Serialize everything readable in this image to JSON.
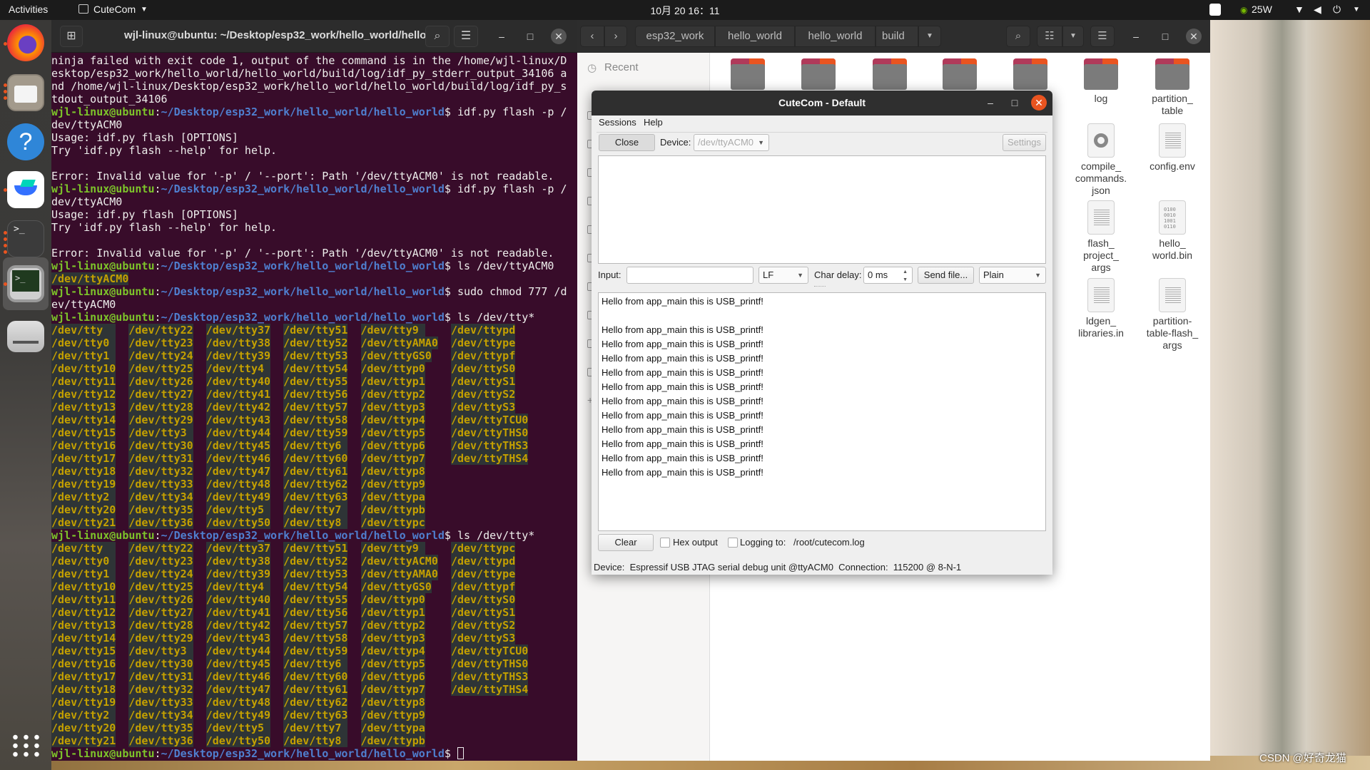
{
  "topbar": {
    "activities": "Activities",
    "app_menu": "CuteCom",
    "clock": "10月 20  16：11",
    "power_draw": "25W"
  },
  "dock": {
    "items": [
      "firefox",
      "files",
      "help",
      "feishu",
      "terminal",
      "terminal-active",
      "drive"
    ],
    "show_apps": "show-apps-grid"
  },
  "terminal": {
    "title": "wjl-linux@ubuntu: ~/Desktop/esp32_work/hello_world/hello...",
    "prompt_user": "wjl-linux@ubuntu",
    "prompt_path": "~/Desktop/esp32_work/hello_world/hello_world",
    "colors": {
      "bg": "#380c2a",
      "user": "#7dc42a",
      "path": "#4f7fcf",
      "highlight_fg": "#c4a000",
      "highlight_bg": "#2e3436"
    },
    "blocks": [
      {
        "type": "text",
        "text": "ninja failed with exit code 1, output of the command is in the /home/wjl-linux/D"
      },
      {
        "type": "text",
        "text": "esktop/esp32_work/hello_world/hello_world/build/log/idf_py_stderr_output_34106 a"
      },
      {
        "type": "text",
        "text": "nd /home/wjl-linux/Desktop/esp32_work/hello_world/hello_world/build/log/idf_py_s"
      },
      {
        "type": "text",
        "text": "tdout_output_34106"
      },
      {
        "type": "prompt",
        "cmd": "$ idf.py flash -p /"
      },
      {
        "type": "text",
        "text": "dev/ttyACM0"
      },
      {
        "type": "text",
        "text": "Usage: idf.py flash [OPTIONS]"
      },
      {
        "type": "text",
        "text": "Try 'idf.py flash --help' for help."
      },
      {
        "type": "text",
        "text": ""
      },
      {
        "type": "text",
        "text": "Error: Invalid value for '-p' / '--port': Path '/dev/ttyACM0' is not readable."
      },
      {
        "type": "prompt",
        "cmd": "$ idf.py flash -p /"
      },
      {
        "type": "text",
        "text": "dev/ttyACM0"
      },
      {
        "type": "text",
        "text": "Usage: idf.py flash [OPTIONS]"
      },
      {
        "type": "text",
        "text": "Try 'idf.py flash --help' for help."
      },
      {
        "type": "text",
        "text": ""
      },
      {
        "type": "text",
        "text": "Error: Invalid value for '-p' / '--port': Path '/dev/ttyACM0' is not readable."
      },
      {
        "type": "prompt",
        "cmd": "$ ls /dev/ttyACM0"
      },
      {
        "type": "hl",
        "text": "/dev/ttyACM0"
      },
      {
        "type": "prompt",
        "cmd": "$ sudo chmod 777 /d"
      },
      {
        "type": "text",
        "text": "ev/ttyACM0"
      },
      {
        "type": "prompt",
        "cmd": "$ ls /dev/tty*"
      },
      {
        "type": "ls",
        "columns": [
          [
            "/dev/tty",
            "/dev/tty0",
            "/dev/tty1",
            "/dev/tty10",
            "/dev/tty11",
            "/dev/tty12",
            "/dev/tty13",
            "/dev/tty14",
            "/dev/tty15",
            "/dev/tty16",
            "/dev/tty17",
            "/dev/tty18",
            "/dev/tty19",
            "/dev/tty2",
            "/dev/tty20",
            "/dev/tty21"
          ],
          [
            "/dev/tty22",
            "/dev/tty23",
            "/dev/tty24",
            "/dev/tty25",
            "/dev/tty26",
            "/dev/tty27",
            "/dev/tty28",
            "/dev/tty29",
            "/dev/tty3",
            "/dev/tty30",
            "/dev/tty31",
            "/dev/tty32",
            "/dev/tty33",
            "/dev/tty34",
            "/dev/tty35",
            "/dev/tty36"
          ],
          [
            "/dev/tty37",
            "/dev/tty38",
            "/dev/tty39",
            "/dev/tty4",
            "/dev/tty40",
            "/dev/tty41",
            "/dev/tty42",
            "/dev/tty43",
            "/dev/tty44",
            "/dev/tty45",
            "/dev/tty46",
            "/dev/tty47",
            "/dev/tty48",
            "/dev/tty49",
            "/dev/tty5",
            "/dev/tty50"
          ],
          [
            "/dev/tty51",
            "/dev/tty52",
            "/dev/tty53",
            "/dev/tty54",
            "/dev/tty55",
            "/dev/tty56",
            "/dev/tty57",
            "/dev/tty58",
            "/dev/tty59",
            "/dev/tty6",
            "/dev/tty60",
            "/dev/tty61",
            "/dev/tty62",
            "/dev/tty63",
            "/dev/tty7",
            "/dev/tty8"
          ],
          [
            "/dev/tty9",
            "/dev/ttyAMA0",
            "/dev/ttyGS0",
            "/dev/ttyp0",
            "/dev/ttyp1",
            "/dev/ttyp2",
            "/dev/ttyp3",
            "/dev/ttyp4",
            "/dev/ttyp5",
            "/dev/ttyp6",
            "/dev/ttyp7",
            "/dev/ttyp8",
            "/dev/ttyp9",
            "/dev/ttypa",
            "/dev/ttypb",
            "/dev/ttypc"
          ],
          [
            "/dev/ttypd",
            "/dev/ttype",
            "/dev/ttypf",
            "/dev/ttyS0",
            "/dev/ttyS1",
            "/dev/ttyS2",
            "/dev/ttyS3",
            "/dev/ttyTCU0",
            "/dev/ttyTHS0",
            "/dev/ttyTHS3",
            "/dev/ttyTHS4"
          ]
        ]
      },
      {
        "type": "prompt",
        "cmd": "$ ls /dev/tty*"
      },
      {
        "type": "ls",
        "columns": [
          [
            "/dev/tty",
            "/dev/tty0",
            "/dev/tty1",
            "/dev/tty10",
            "/dev/tty11",
            "/dev/tty12",
            "/dev/tty13",
            "/dev/tty14",
            "/dev/tty15",
            "/dev/tty16",
            "/dev/tty17",
            "/dev/tty18",
            "/dev/tty19",
            "/dev/tty2",
            "/dev/tty20",
            "/dev/tty21"
          ],
          [
            "/dev/tty22",
            "/dev/tty23",
            "/dev/tty24",
            "/dev/tty25",
            "/dev/tty26",
            "/dev/tty27",
            "/dev/tty28",
            "/dev/tty29",
            "/dev/tty3",
            "/dev/tty30",
            "/dev/tty31",
            "/dev/tty32",
            "/dev/tty33",
            "/dev/tty34",
            "/dev/tty35",
            "/dev/tty36"
          ],
          [
            "/dev/tty37",
            "/dev/tty38",
            "/dev/tty39",
            "/dev/tty4",
            "/dev/tty40",
            "/dev/tty41",
            "/dev/tty42",
            "/dev/tty43",
            "/dev/tty44",
            "/dev/tty45",
            "/dev/tty46",
            "/dev/tty47",
            "/dev/tty48",
            "/dev/tty49",
            "/dev/tty5",
            "/dev/tty50"
          ],
          [
            "/dev/tty51",
            "/dev/tty52",
            "/dev/tty53",
            "/dev/tty54",
            "/dev/tty55",
            "/dev/tty56",
            "/dev/tty57",
            "/dev/tty58",
            "/dev/tty59",
            "/dev/tty6",
            "/dev/tty60",
            "/dev/tty61",
            "/dev/tty62",
            "/dev/tty63",
            "/dev/tty7",
            "/dev/tty8"
          ],
          [
            "/dev/tty9",
            "/dev/ttyACM0",
            "/dev/ttyAMA0",
            "/dev/ttyGS0",
            "/dev/ttyp0",
            "/dev/ttyp1",
            "/dev/ttyp2",
            "/dev/ttyp3",
            "/dev/ttyp4",
            "/dev/ttyp5",
            "/dev/ttyp6",
            "/dev/ttyp7",
            "/dev/ttyp8",
            "/dev/ttyp9",
            "/dev/ttypa",
            "/dev/ttypb"
          ],
          [
            "/dev/ttypc",
            "/dev/ttypd",
            "/dev/ttype",
            "/dev/ttypf",
            "/dev/ttyS0",
            "/dev/ttyS1",
            "/dev/ttyS2",
            "/dev/ttyS3",
            "/dev/ttyTCU0",
            "/dev/ttyTHS0",
            "/dev/ttyTHS3",
            "/dev/ttyTHS4"
          ]
        ]
      },
      {
        "type": "prompt",
        "cmd": "$ ",
        "cursor": true
      }
    ]
  },
  "file_manager": {
    "breadcrumbs": [
      "esp32_work",
      "hello_world",
      "hello_world",
      "build"
    ],
    "sidebar": {
      "recent": "Recent"
    },
    "folders": [
      "",
      "",
      "",
      "",
      "",
      "log",
      "partition_\ntable"
    ],
    "files": [
      {
        "name": "compile_\ncommands.\njson",
        "icon": "json-file-icon"
      },
      {
        "name": "config.env",
        "icon": "text-file-icon"
      },
      {
        "name": "flash_\nproject_\nargs",
        "icon": "text-file-icon"
      },
      {
        "name": "hello_\nworld.bin",
        "icon": "binary-file-icon"
      },
      {
        "name": "ldgen_\nlibraries.in",
        "icon": "text-file-icon"
      },
      {
        "name": "partition-\ntable-flash_\nargs",
        "icon": "text-file-icon"
      }
    ]
  },
  "cutecom": {
    "title": "CuteCom - Default",
    "menu": [
      "Sessions",
      "Help"
    ],
    "close_button": "Close",
    "device_label": "Device:",
    "device_value": "/dev/ttyACM0",
    "settings_button": "Settings",
    "input_label": "Input:",
    "input_value": "",
    "line_end": "LF",
    "char_delay_label": "Char delay:",
    "char_delay_value": "0 ms",
    "send_file_button": "Send file...",
    "format": "Plain",
    "received_lines": [
      "Hello from app_main this is USB_printf!",
      "",
      "Hello from app_main this is USB_printf!",
      "Hello from app_main this is USB_printf!",
      "Hello from app_main this is USB_printf!",
      "Hello from app_main this is USB_printf!",
      "Hello from app_main this is USB_printf!",
      "Hello from app_main this is USB_printf!",
      "Hello from app_main this is USB_printf!",
      "Hello from app_main this is USB_printf!",
      "Hello from app_main this is USB_printf!",
      "Hello from app_main this is USB_printf!",
      "Hello from app_main this is USB_printf!"
    ],
    "clear_button": "Clear",
    "hex_output_label": "Hex output",
    "hex_output_checked": false,
    "logging_label": "Logging to:",
    "logging_checked": false,
    "log_path": "/root/cutecom.log",
    "status": {
      "device_label": "Device:",
      "device": "Espressif USB JTAG serial debug unit @ttyACM0",
      "connection_label": "Connection:",
      "connection": "115200 @ 8-N-1"
    },
    "close_color": "#e95420"
  },
  "watermark": "CSDN @好奇龙猫"
}
